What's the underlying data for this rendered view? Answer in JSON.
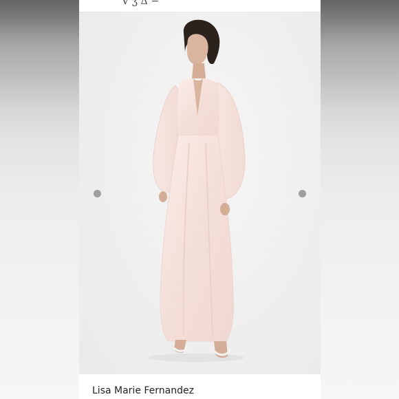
{
  "header": {
    "logo_fragment": "V ʒ Δ −"
  },
  "gallery": {
    "prev_icon": "chevron-left-icon",
    "next_icon": "chevron-right-icon",
    "image_subject": "model-in-long-dress"
  },
  "listing": {
    "brand": "Lisa Marie Fernandez"
  },
  "colors": {
    "dress": "#f6e3dd",
    "background": "#efeeee",
    "dot": "#9e9e9e"
  }
}
